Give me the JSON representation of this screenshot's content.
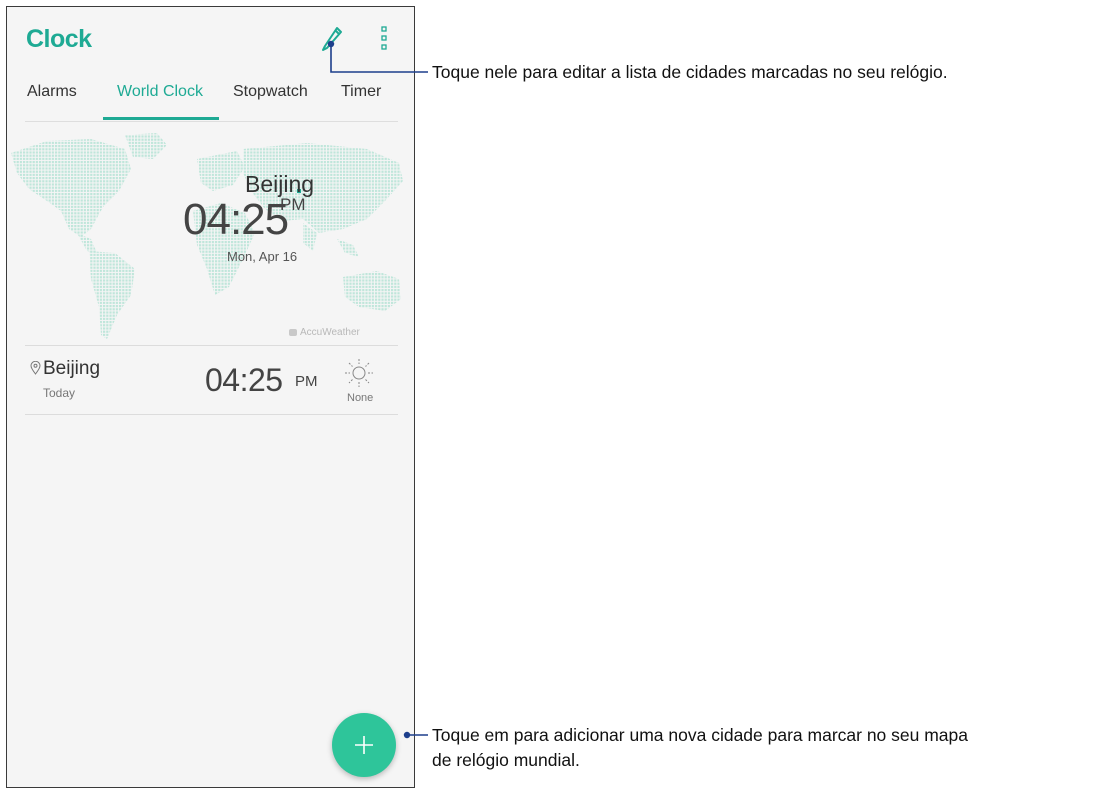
{
  "app": {
    "title": "Clock"
  },
  "header": {
    "edit_icon": "pencil-icon",
    "more_icon": "more-vertical-icon"
  },
  "tabs": [
    {
      "label": "Alarms",
      "active": false
    },
    {
      "label": "World Clock",
      "active": true
    },
    {
      "label": "Stopwatch",
      "active": false
    },
    {
      "label": "Timer",
      "active": false
    }
  ],
  "hero": {
    "city": "Beijing",
    "time": "04:25",
    "ampm": "PM",
    "date": "Mon, Apr 16"
  },
  "provider": "AccuWeather",
  "cities": [
    {
      "name": "Beijing",
      "day": "Today",
      "time": "04:25",
      "ampm": "PM",
      "weather": "None",
      "weather_icon": "sun-icon"
    }
  ],
  "fab": {
    "icon": "plus-icon"
  },
  "callouts": {
    "edit": "Toque nele para editar a lista de cidades marcadas no seu relógio.",
    "add_line1": "Toque em para adicionar uma nova cidade para marcar no seu mapa",
    "add_line2": "de relógio mundial."
  },
  "colors": {
    "accent": "#1eaa94",
    "fab": "#2ec59a",
    "map_dots": "#bfe6da",
    "callout_line": "#1d3f8c"
  }
}
